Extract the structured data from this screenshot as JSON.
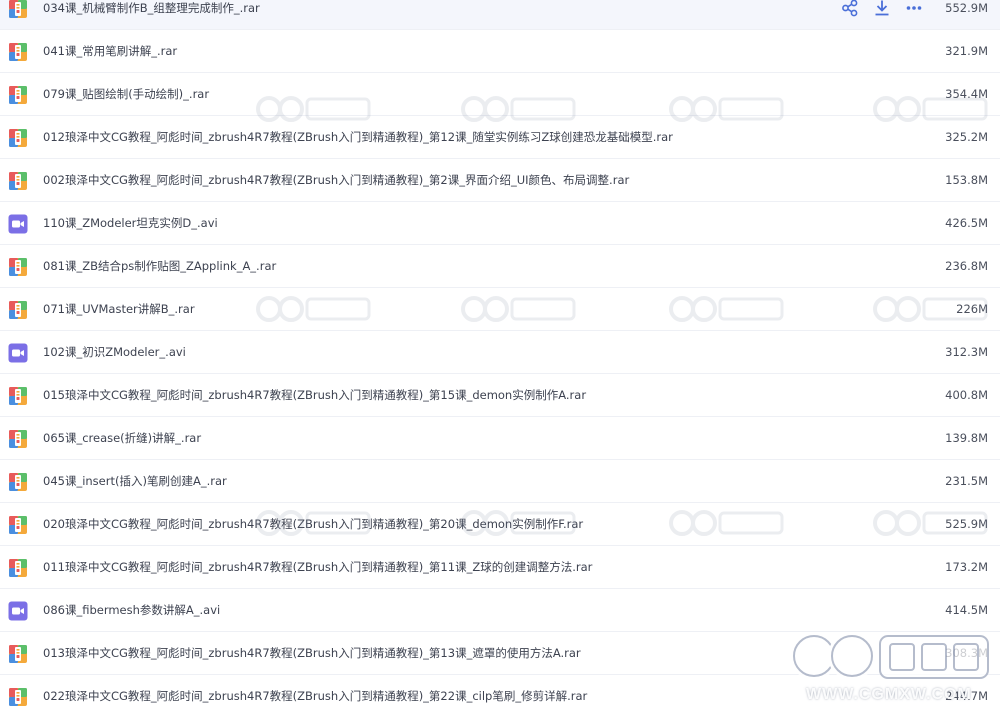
{
  "files": [
    {
      "name": "034课_机械臂制作B_组整理完成制作_.rar",
      "size": "552.9M",
      "type": "rar"
    },
    {
      "name": "041课_常用笔刷讲解_.rar",
      "size": "321.9M",
      "type": "rar"
    },
    {
      "name": "079课_贴图绘制(手动绘制)_.rar",
      "size": "354.4M",
      "type": "rar"
    },
    {
      "name": "012琅泽中文CG教程_阿彪时间_zbrush4R7教程(ZBrush入门到精通教程)_第12课_随堂实例练习Z球创建恐龙基础模型.rar",
      "size": "325.2M",
      "type": "rar"
    },
    {
      "name": "002琅泽中文CG教程_阿彪时间_zbrush4R7教程(ZBrush入门到精通教程)_第2课_界面介绍_UI颜色、布局调整.rar",
      "size": "153.8M",
      "type": "rar"
    },
    {
      "name": "110课_ZModeler坦克实例D_.avi",
      "size": "426.5M",
      "type": "avi"
    },
    {
      "name": "081课_ZB结合ps制作贴图_ZApplink_A_.rar",
      "size": "236.8M",
      "type": "rar"
    },
    {
      "name": "071课_UVMaster讲解B_.rar",
      "size": "226M",
      "type": "rar"
    },
    {
      "name": "102课_初识ZModeler_.avi",
      "size": "312.3M",
      "type": "avi"
    },
    {
      "name": "015琅泽中文CG教程_阿彪时间_zbrush4R7教程(ZBrush入门到精通教程)_第15课_demon实例制作A.rar",
      "size": "400.8M",
      "type": "rar"
    },
    {
      "name": "065课_crease(折缝)讲解_.rar",
      "size": "139.8M",
      "type": "rar"
    },
    {
      "name": "045课_insert(插入)笔刷创建A_.rar",
      "size": "231.5M",
      "type": "rar"
    },
    {
      "name": "020琅泽中文CG教程_阿彪时间_zbrush4R7教程(ZBrush入门到精通教程)_第20课_demon实例制作F.rar",
      "size": "525.9M",
      "type": "rar"
    },
    {
      "name": "011琅泽中文CG教程_阿彪时间_zbrush4R7教程(ZBrush入门到精通教程)_第11课_Z球的创建调整方法.rar",
      "size": "173.2M",
      "type": "rar"
    },
    {
      "name": "086课_fibermesh参数讲解A_.avi",
      "size": "414.5M",
      "type": "avi"
    },
    {
      "name": "013琅泽中文CG教程_阿彪时间_zbrush4R7教程(ZBrush入门到精通教程)_第13课_遮罩的使用方法A.rar",
      "size": "308.3M",
      "type": "rar"
    },
    {
      "name": "022琅泽中文CG教程_阿彪时间_zbrush4R7教程(ZBrush入门到精通教程)_第22课_cilp笔刷_修剪详解.rar",
      "size": "244.7M",
      "type": "rar"
    }
  ],
  "hovered_row_index": 0,
  "row_actions": [
    "share-icon",
    "download-icon",
    "more-icon"
  ],
  "watermark": {
    "logo_text": "CG模型主",
    "url": "WWW.CGMXW.COM"
  },
  "colors": {
    "accent": "#4a6fd8",
    "video_icon": "#7b6fe6",
    "row_hover": "#f4f6fc",
    "text": "#3d4250"
  }
}
